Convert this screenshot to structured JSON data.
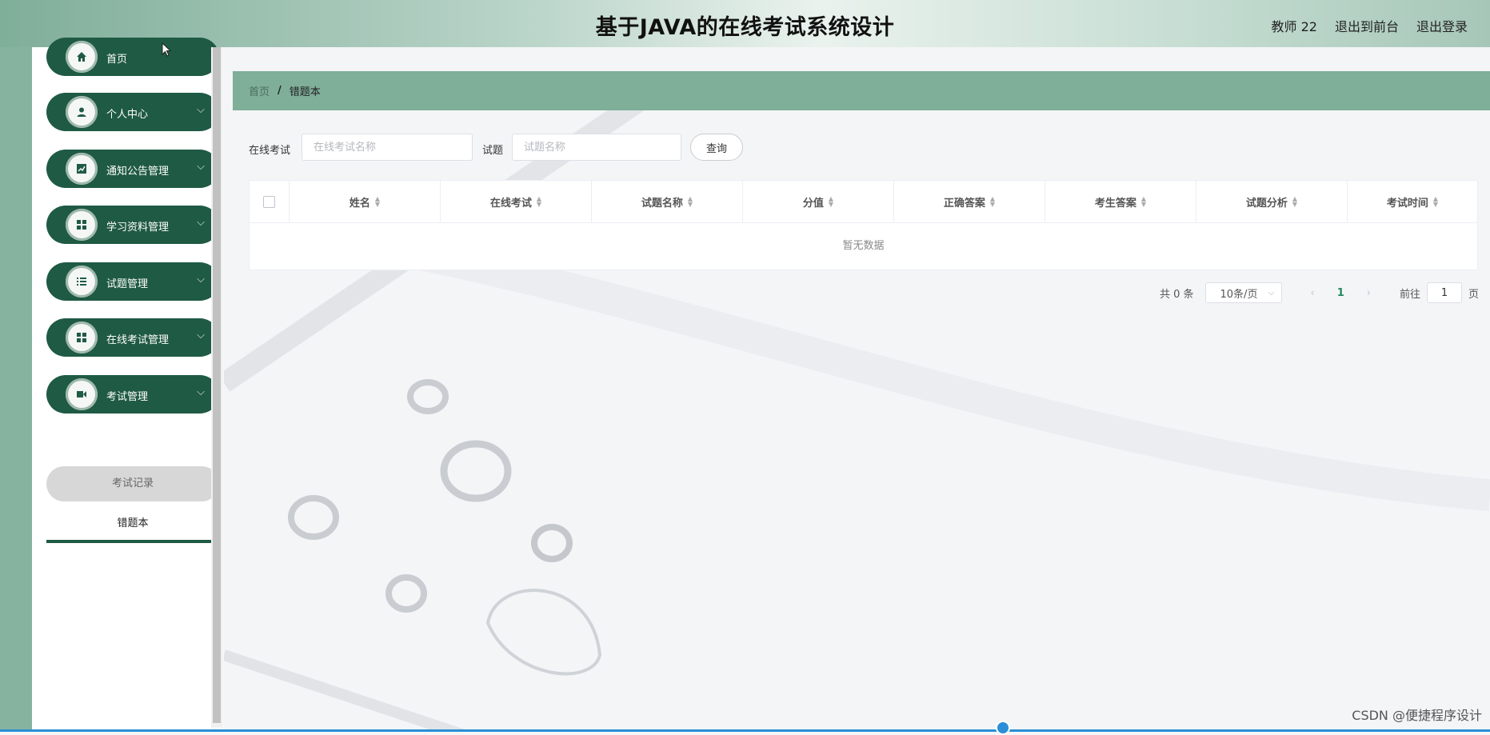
{
  "header": {
    "title": "基于JAVA的在线考试系统设计",
    "user": "教师 22",
    "front_link": "退出到前台",
    "logout_link": "退出登录"
  },
  "sidebar": {
    "items": [
      {
        "label": "首页",
        "icon": "home-icon"
      },
      {
        "label": "个人中心",
        "icon": "user-icon"
      },
      {
        "label": "通知公告管理",
        "icon": "chart-icon"
      },
      {
        "label": "学习资料管理",
        "icon": "grid-icon"
      },
      {
        "label": "试题管理",
        "icon": "list-icon"
      },
      {
        "label": "在线考试管理",
        "icon": "grid-icon"
      },
      {
        "label": "考试管理",
        "icon": "video-icon"
      }
    ],
    "sub_items": [
      {
        "label": "考试记录"
      },
      {
        "label": "错题本"
      }
    ]
  },
  "breadcrumb": {
    "home": "首页",
    "separator": "/",
    "current": "错题本"
  },
  "search": {
    "exam_label": "在线考试",
    "exam_placeholder": "在线考试名称",
    "question_label": "试题",
    "question_placeholder": "试题名称",
    "query_button": "查询"
  },
  "table": {
    "columns": [
      "姓名",
      "在线考试",
      "试题名称",
      "分值",
      "正确答案",
      "考生答案",
      "试题分析",
      "考试时间"
    ],
    "empty_text": "暂无数据"
  },
  "pagination": {
    "total": "共 0 条",
    "page_size": "10条/页",
    "current_page": "1",
    "goto_label": "前往",
    "goto_value": "1",
    "page_suffix": "页"
  },
  "watermark": "CSDN @便捷程序设计",
  "colors": {
    "sidebar_green": "#1f5a44",
    "crumb_bar": "#7fae99",
    "active_page": "#1f8a5a"
  }
}
